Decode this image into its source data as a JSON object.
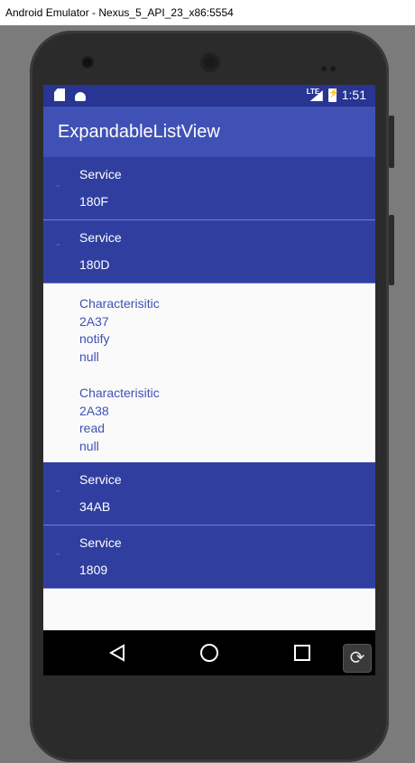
{
  "window": {
    "title": "Android Emulator - Nexus_5_API_23_x86:5554"
  },
  "status_bar": {
    "network": "LTE",
    "time": "1:51"
  },
  "app_bar": {
    "title": "ExpandableListView"
  },
  "groups": [
    {
      "line1": "Service",
      "line2": "180F",
      "expanded": false
    },
    {
      "line1": "Service",
      "line2": "180D",
      "expanded": true,
      "children": [
        {
          "lines": [
            "Characterisitic",
            "2A37",
            "notify",
            "null"
          ]
        },
        {
          "lines": [
            "Characterisitic",
            "2A38",
            "read",
            "null"
          ]
        }
      ]
    },
    {
      "line1": "Service",
      "line2": "34AB",
      "expanded": false
    },
    {
      "line1": "Service",
      "line2": "1809",
      "expanded": false
    }
  ],
  "icons": {
    "collapsed_indicator": "chevron-down-icon",
    "expanded_indicator": "chevron-up-icon",
    "nav_back": "back-triangle-icon",
    "nav_home": "home-circle-icon",
    "nav_recent": "recent-square-icon",
    "rotate": "rotate-icon"
  },
  "colors": {
    "status_bar": "#283593",
    "app_bar": "#3f51b5",
    "group_background": "#303f9f",
    "child_text": "#3f51b5"
  }
}
